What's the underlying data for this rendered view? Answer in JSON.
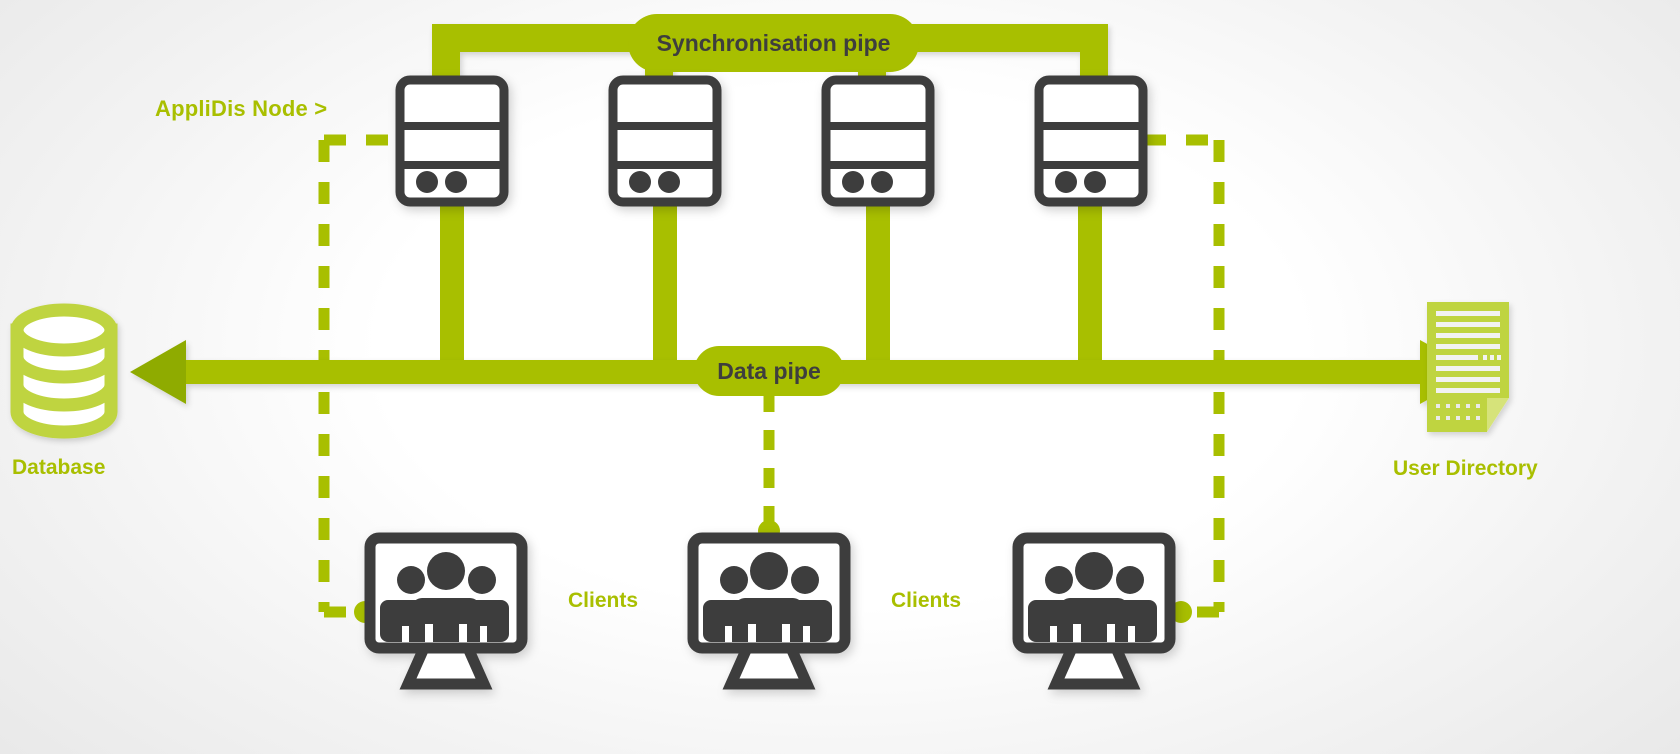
{
  "diagram": {
    "title": "AppliDis Node Architecture",
    "colors": {
      "pipe_green": "#a8bf00",
      "light_green": "#bfd440",
      "dark_gray": "#3e3e3e",
      "white": "#ffffff",
      "label_green": "#a9bf00"
    },
    "labels": {
      "sync_pipe": "Synchronisation pipe",
      "data_pipe": "Data pipe",
      "applidis_node": "AppliDis Node >",
      "database": "Database",
      "user_directory": "User Directory",
      "clients_left": "Clients",
      "clients_right": "Clients"
    },
    "nodes": [
      {
        "name": "applidis-node-1",
        "icon": "server-icon"
      },
      {
        "name": "applidis-node-2",
        "icon": "server-icon"
      },
      {
        "name": "applidis-node-3",
        "icon": "server-icon"
      },
      {
        "name": "applidis-node-4",
        "icon": "server-icon"
      }
    ],
    "clients": [
      {
        "name": "client-monitor-1",
        "icon": "monitor-users-icon"
      },
      {
        "name": "client-monitor-2",
        "icon": "monitor-users-icon"
      },
      {
        "name": "client-monitor-3",
        "icon": "monitor-users-icon"
      }
    ],
    "endpoints": [
      {
        "name": "database",
        "icon": "database-cylinder-icon"
      },
      {
        "name": "user-directory",
        "icon": "document-lines-icon"
      }
    ]
  }
}
